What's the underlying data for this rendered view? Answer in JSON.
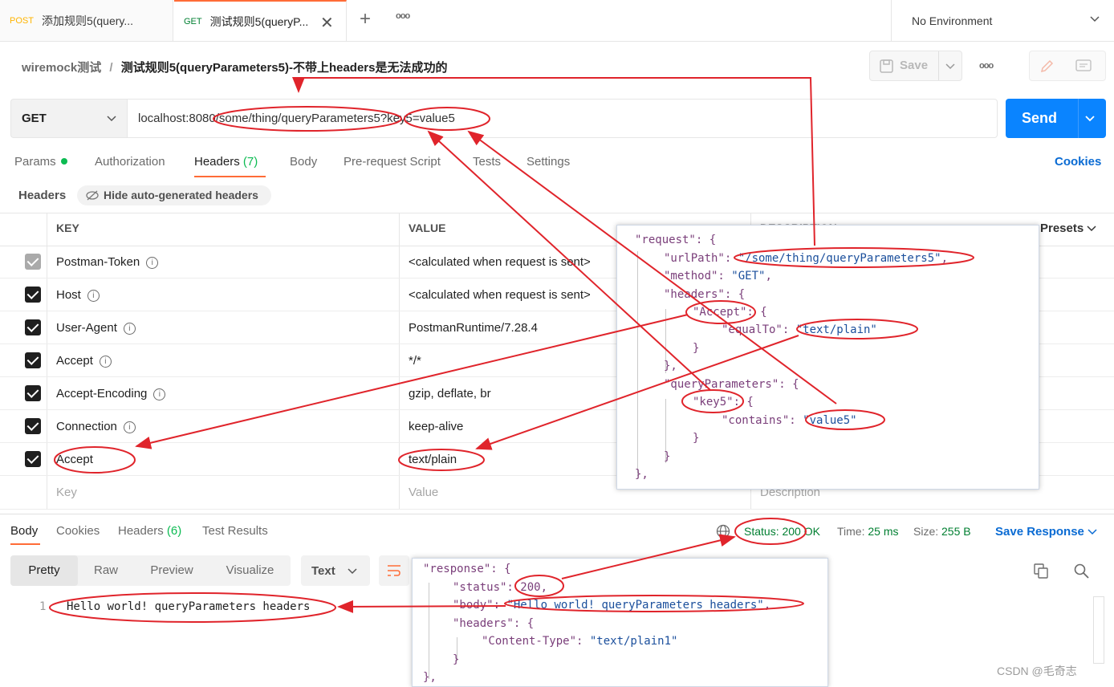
{
  "tabs": [
    {
      "method": "POST",
      "label": "添加规则5(query..."
    },
    {
      "method": "GET",
      "label": "测试规则5(queryP..."
    }
  ],
  "tab_actions": {
    "new": "+",
    "more": "ooo"
  },
  "environment": "No Environment",
  "breadcrumb": {
    "collection": "wiremock测试",
    "separator": "/",
    "request": "测试规则5(queryParameters5)-不带上headers是无法成功的"
  },
  "toolbar": {
    "save": "Save",
    "more": "ooo"
  },
  "request": {
    "method": "GET",
    "url": "localhost:8080/some/thing/queryParameters5?key5=value5",
    "send": "Send"
  },
  "request_tabs": {
    "params": "Params",
    "authorization": "Authorization",
    "headers": "Headers",
    "headers_count": "(7)",
    "body": "Body",
    "prerequest": "Pre-request Script",
    "tests": "Tests",
    "settings": "Settings",
    "cookies": "Cookies"
  },
  "headers_section": {
    "title": "Headers",
    "hide_auto": "Hide auto-generated headers"
  },
  "table": {
    "key_header": "KEY",
    "value_header": "VALUE",
    "desc_header": "DESCRIPTION",
    "presets": "Presets",
    "rows": [
      {
        "key": "Postman-Token",
        "value": "<calculated when request is sent>"
      },
      {
        "key": "Host",
        "value": "<calculated when request is sent>"
      },
      {
        "key": "User-Agent",
        "value": "PostmanRuntime/7.28.4"
      },
      {
        "key": "Accept",
        "value": "*/*"
      },
      {
        "key": "Accept-Encoding",
        "value": "gzip, deflate, br"
      },
      {
        "key": "Connection",
        "value": "keep-alive"
      },
      {
        "key": "Accept",
        "value": "text/plain"
      }
    ],
    "placeholder": {
      "key": "Key",
      "value": "Value",
      "description": "Description"
    }
  },
  "response_tabs": {
    "body": "Body",
    "cookies": "Cookies",
    "headers": "Headers",
    "headers_count": "(6)",
    "test_results": "Test Results"
  },
  "response_meta": {
    "status": "Status: 200 OK",
    "time_label": "Time:",
    "time": "25 ms",
    "size_label": "Size:",
    "size": "255 B",
    "save_response": "Save Response"
  },
  "view_modes": {
    "pretty": "Pretty",
    "raw": "Raw",
    "preview": "Preview",
    "visualize": "Visualize",
    "format": "Text"
  },
  "response_body": {
    "line": "1",
    "text": "Hello world! queryParameters headers"
  },
  "request_json": [
    "\"request\": {",
    "\"urlPath\": \"/some/thing/queryParameters5\",",
    "\"method\": \"GET\",",
    "\"headers\": {",
    "\"Accept\": {",
    "\"equalTo\": \"text/plain\"",
    "}",
    "},",
    "\"queryParameters\": {",
    "\"key5\": {",
    "\"contains\": \"value5\"",
    "}",
    "}",
    "},"
  ],
  "response_json": [
    "\"response\": {",
    "\"status\": 200,",
    "\"body\": \"Hello world! queryParameters headers\",",
    "\"headers\": {",
    "\"Content-Type\": \"text/plain1\"",
    "}",
    "},"
  ],
  "watermark": "CSDN @毛奇志",
  "colors": {
    "accent": "#ff6c37",
    "send": "#0a84ff",
    "link": "#0a6bd3",
    "status_ok": "#007f31",
    "annotation": "#e0242b",
    "json_key": "#7a3e7a",
    "json_string": "#1b4f9c"
  }
}
